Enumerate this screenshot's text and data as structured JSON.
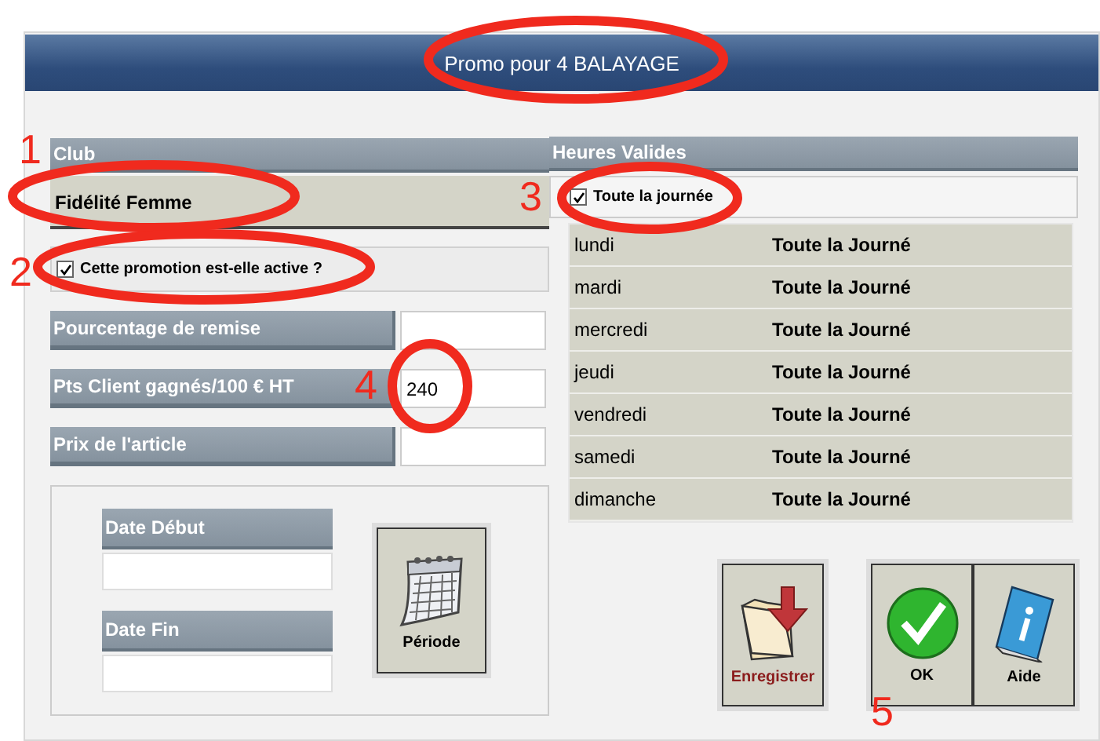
{
  "window": {
    "title": "Promo pour 4 BALAYAGE"
  },
  "club": {
    "label": "Club",
    "value": "Fidélité Femme"
  },
  "active": {
    "label": "Cette promotion est-elle active ?",
    "checked": true
  },
  "fields": [
    {
      "label": "Pourcentage de remise"
    },
    {
      "label": "Pts Client gagnés/100 € HT",
      "value": "240"
    },
    {
      "label": "Prix de l'article"
    }
  ],
  "dates": [
    {
      "label": "Date Début"
    },
    {
      "label": "Date Fin"
    }
  ],
  "period_button": "Période",
  "hours": {
    "label": "Heures Valides",
    "all_day": {
      "label": "Toute la journée",
      "checked": true
    },
    "rows": [
      {
        "day": "lundi",
        "hours": "Toute la Journé"
      },
      {
        "day": "mardi",
        "hours": "Toute la Journé"
      },
      {
        "day": "mercredi",
        "hours": "Toute la Journé"
      },
      {
        "day": "jeudi",
        "hours": "Toute la Journé"
      },
      {
        "day": "vendredi",
        "hours": "Toute la Journé"
      },
      {
        "day": "samedi",
        "hours": "Toute la Journé"
      },
      {
        "day": "dimanche",
        "hours": "Toute la Journé"
      }
    ]
  },
  "buttons": [
    {
      "kind": "save",
      "label": "Enregistrer"
    },
    {
      "kind": "ok",
      "label": "OK"
    },
    {
      "kind": "help",
      "label": "Aide"
    }
  ],
  "annotation_numbers": [
    "1",
    "2",
    "3",
    "4",
    "5"
  ]
}
